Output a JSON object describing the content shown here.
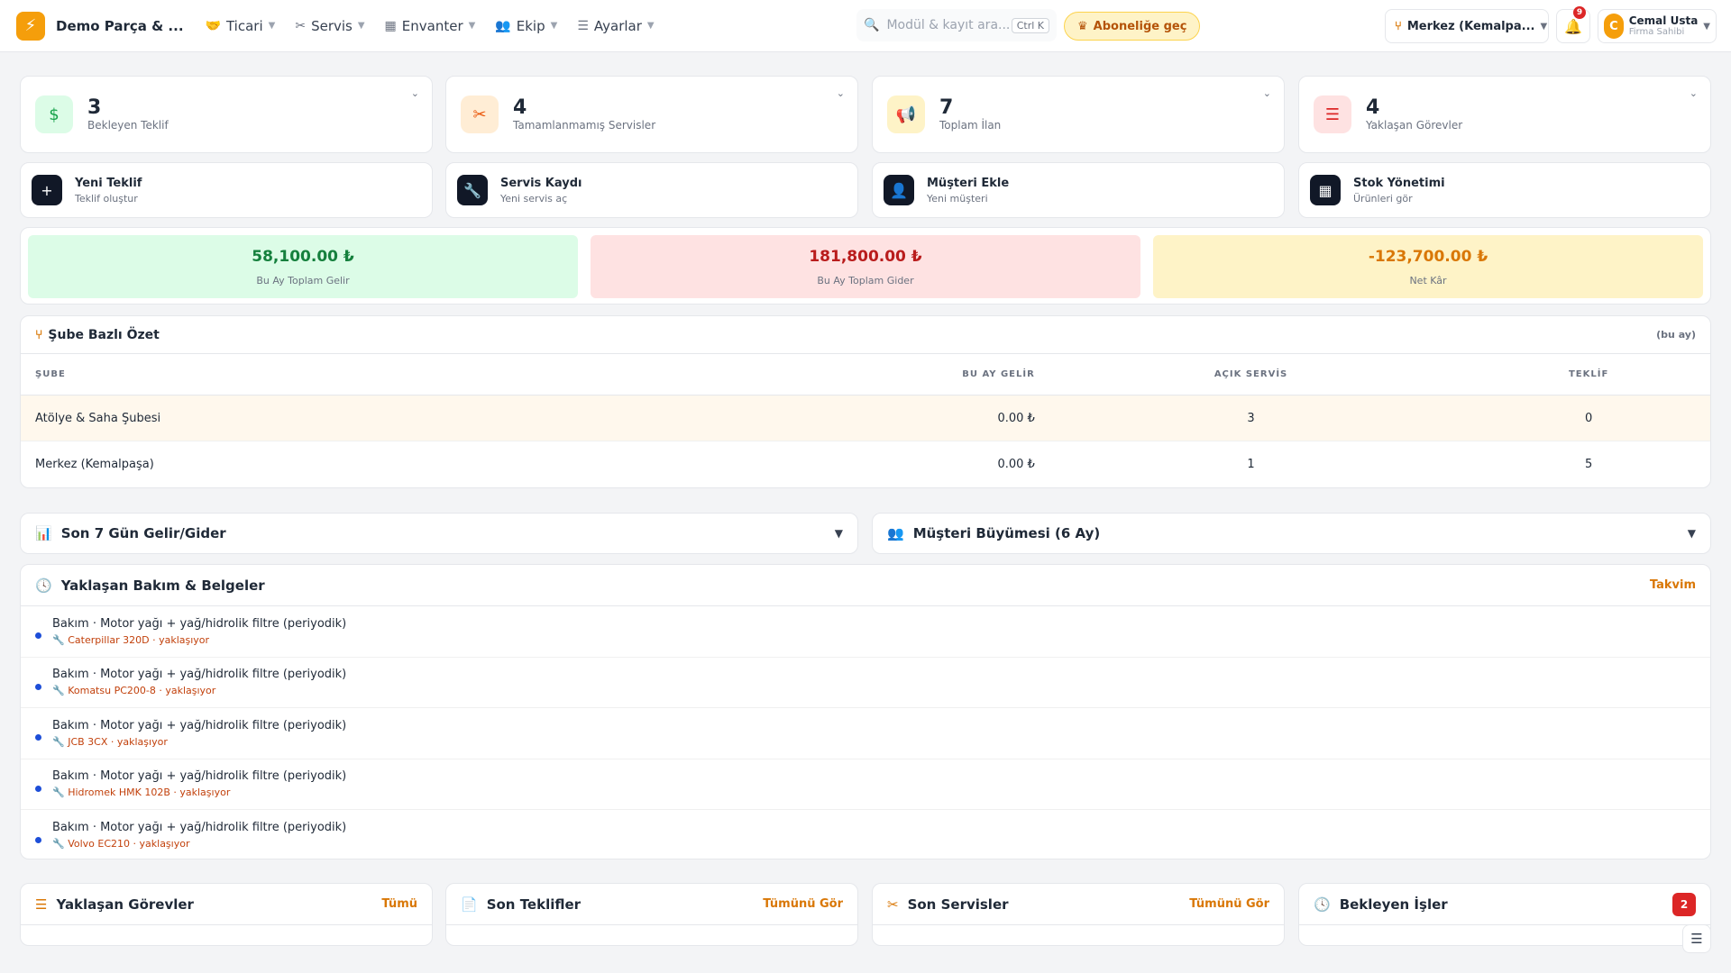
{
  "header": {
    "brand": "Demo Parça & ...",
    "menu": [
      {
        "label": "Ticari",
        "icon": "handshake-icon"
      },
      {
        "label": "Servis",
        "icon": "tools-icon"
      },
      {
        "label": "Envanter",
        "icon": "boxes-icon"
      },
      {
        "label": "Ekip",
        "icon": "users-icon"
      },
      {
        "label": "Ayarlar",
        "icon": "sliders-icon"
      }
    ],
    "search_placeholder": "Modül & kayıt ara...",
    "search_shortcut": "Ctrl K",
    "subscribe_label": "Aboneliğe geç",
    "branch": "Merkez (Kemalpa...",
    "notifications": "9",
    "user_initial": "C",
    "user_name": "Cemal Usta",
    "user_role": "Firma Sahibi"
  },
  "stats": [
    {
      "value": "3",
      "label": "Bekleyen Teklif",
      "icon": "file-invoice-icon",
      "bg": "#dcfce7",
      "fg": "#16a34a"
    },
    {
      "value": "4",
      "label": "Tamamlanmamış Servisler",
      "icon": "tools-icon",
      "bg": "#ffedd5",
      "fg": "#ea580c"
    },
    {
      "value": "7",
      "label": "Toplam İlan",
      "icon": "megaphone-icon",
      "bg": "#fef3c7",
      "fg": "#d97706"
    },
    {
      "value": "4",
      "label": "Yaklaşan Görevler",
      "icon": "tasks-icon",
      "bg": "#fee2e2",
      "fg": "#dc2626"
    }
  ],
  "quick_actions": [
    {
      "title": "Yeni Teklif",
      "sub": "Teklif oluştur",
      "icon": "plus-icon"
    },
    {
      "title": "Servis Kaydı",
      "sub": "Yeni servis aç",
      "icon": "wrench-icon"
    },
    {
      "title": "Müşteri Ekle",
      "sub": "Yeni müşteri",
      "icon": "user-plus-icon"
    },
    {
      "title": "Stok Yönetimi",
      "sub": "Ürünleri gör",
      "icon": "boxes-icon"
    }
  ],
  "finance": [
    {
      "value": "58,100.00 ₺",
      "label": "Bu Ay Toplam Gelir",
      "bg": "#dcfce7",
      "fg": "#15803d"
    },
    {
      "value": "181,800.00 ₺",
      "label": "Bu Ay Toplam Gider",
      "bg": "#fee2e2",
      "fg": "#b91c1c"
    },
    {
      "value": "-123,700.00 ₺",
      "label": "Net Kâr",
      "bg": "#fef3c7",
      "fg": "#d97706"
    }
  ],
  "branch_summary": {
    "title": "Şube Bazlı Özet",
    "period": "(bu ay)",
    "columns": [
      "ŞUBE",
      "BU AY GELİR",
      "AÇIK SERVİS",
      "TEKLİF"
    ],
    "rows": [
      [
        "Atölye & Saha Şubesi",
        "0.00 ₺",
        "3",
        "0"
      ],
      [
        "Merkez (Kemalpaşa)",
        "0.00 ₺",
        "1",
        "5"
      ]
    ]
  },
  "charts": {
    "income_expense": "Son 7 Gün Gelir/Gider",
    "customer_growth": "Müşteri Büyümesi (6 Ay)"
  },
  "maintenance": {
    "title": "Yaklaşan Bakım & Belgeler",
    "link": "Takvim",
    "items": [
      {
        "title": "Bakım · Motor yağı + yağ/hidrolik filtre (periyodik)",
        "sub": "Caterpillar 320D · yaklaşıyor"
      },
      {
        "title": "Bakım · Motor yağı + yağ/hidrolik filtre (periyodik)",
        "sub": "Komatsu PC200-8 · yaklaşıyor"
      },
      {
        "title": "Bakım · Motor yağı + yağ/hidrolik filtre (periyodik)",
        "sub": "JCB 3CX · yaklaşıyor"
      },
      {
        "title": "Bakım · Motor yağı + yağ/hidrolik filtre (periyodik)",
        "sub": "Hidromek HMK 102B · yaklaşıyor"
      },
      {
        "title": "Bakım · Motor yağı + yağ/hidrolik filtre (periyodik)",
        "sub": "Volvo EC210 · yaklaşıyor"
      }
    ]
  },
  "bottom_cards": [
    {
      "title": "Yaklaşan Görevler",
      "link": "Tümü",
      "icon": "tasks-icon"
    },
    {
      "title": "Son Teklifler",
      "link": "Tümünü Gör",
      "icon": "file-invoice-icon"
    },
    {
      "title": "Son Servisler",
      "link": "Tümünü Gör",
      "icon": "tools-icon"
    },
    {
      "title": "Bekleyen İşler",
      "count": "2",
      "icon": "clock-icon"
    }
  ]
}
